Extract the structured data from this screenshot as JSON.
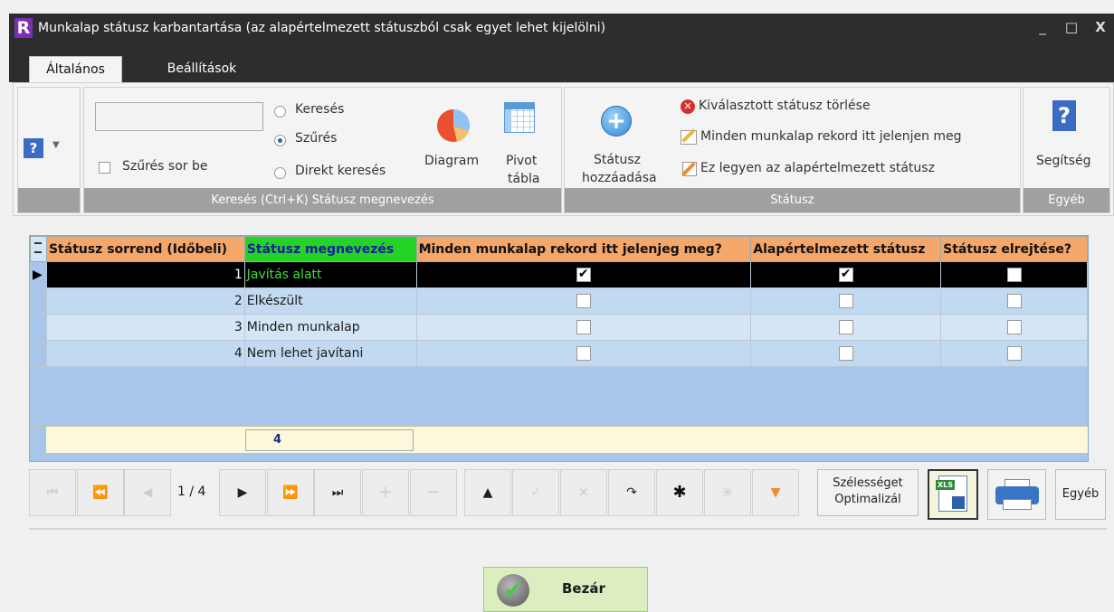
{
  "window": {
    "title": "Munkalap státusz karbantartása (az alapértelmezett státuszból csak egyet lehet kijelölni)",
    "logo": "R",
    "minimize": "_",
    "maximize": "□",
    "close": "X"
  },
  "tabs": [
    "Általános",
    "Beállítások"
  ],
  "ribbon": {
    "search_group": {
      "input_value": "",
      "filter_row_label": "Szűrés sor be",
      "radios": [
        "Keresés",
        "Szűrés",
        "Direkt keresés"
      ],
      "selected_radio": "Szűrés",
      "diagram_label": "Diagram",
      "pivot_label_1": "Pivot",
      "pivot_label_2": "tábla",
      "caption": "Keresés (Ctrl+K) Státusz megnevezés"
    },
    "status_group": {
      "add_label_1": "Státusz",
      "add_label_2": "hozzáadása",
      "delete_label": "Kiválasztott státusz törlése",
      "show_all_label": "Minden munkalap rekord itt jelenjen meg",
      "default_label": "Ez legyen az alapértelmezett státusz",
      "caption": "Státusz"
    },
    "other_group": {
      "help_label": "Segítség",
      "caption": "Egyéb"
    }
  },
  "grid": {
    "columns": [
      "Státusz sorrend (Időbeli)",
      "Státusz megnevezés",
      "Minden munkalap rekord itt jelenjeg meg?",
      "Alapértelmezett státusz",
      "Státusz elrejtése?"
    ],
    "rows": [
      {
        "order": "1",
        "name": "Javítás alatt",
        "show_all": true,
        "default": true,
        "hidden": false
      },
      {
        "order": "2",
        "name": "Elkészült",
        "show_all": false,
        "default": false,
        "hidden": false
      },
      {
        "order": "3",
        "name": "Minden munkalap",
        "show_all": false,
        "default": false,
        "hidden": false
      },
      {
        "order": "4",
        "name": "Nem lehet javítani",
        "show_all": false,
        "default": false,
        "hidden": false
      }
    ],
    "summary_count": "4"
  },
  "navigator": {
    "position": "1 / 4",
    "optimize_label_1": "Szélességet",
    "optimize_label_2": "Optimalizál",
    "other_label": "Egyéb",
    "xls_badge": "XLS"
  },
  "close_button": "Bezár",
  "colors": {
    "header_orange": "#f5a66a",
    "header_green": "#24d424",
    "grid_blue": "#a8c6ea",
    "titlebar": "#2d2d2d"
  }
}
